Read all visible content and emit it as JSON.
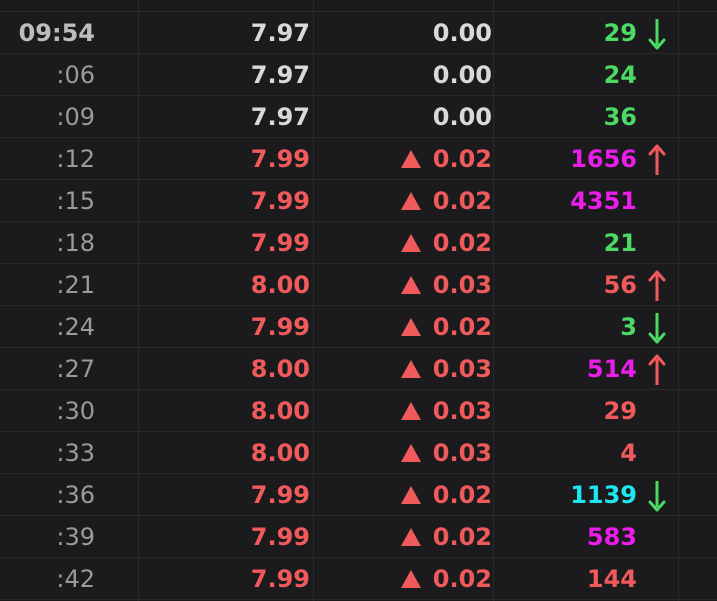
{
  "colors": {
    "background": "#1b1b1d",
    "up_red": "#f05a5a",
    "down_green": "#4cd964",
    "large_magenta": "#ea1dea",
    "huge_cyan": "#1ee6f0",
    "neutral_white": "#d9d9d9"
  },
  "rows": [
    {
      "time": "09:54",
      "price": "7.97",
      "change": "0.00",
      "volume": "29",
      "price_color": "white",
      "volume_color": "green",
      "up_tri": false,
      "arrow": "down"
    },
    {
      "time": ":06",
      "price": "7.97",
      "change": "0.00",
      "volume": "24",
      "price_color": "white",
      "volume_color": "green",
      "up_tri": false,
      "arrow": ""
    },
    {
      "time": ":09",
      "price": "7.97",
      "change": "0.00",
      "volume": "36",
      "price_color": "white",
      "volume_color": "green",
      "up_tri": false,
      "arrow": ""
    },
    {
      "time": ":12",
      "price": "7.99",
      "change": "0.02",
      "volume": "1656",
      "price_color": "red",
      "volume_color": "magenta",
      "up_tri": true,
      "arrow": "up"
    },
    {
      "time": ":15",
      "price": "7.99",
      "change": "0.02",
      "volume": "4351",
      "price_color": "red",
      "volume_color": "magenta",
      "up_tri": true,
      "arrow": ""
    },
    {
      "time": ":18",
      "price": "7.99",
      "change": "0.02",
      "volume": "21",
      "price_color": "red",
      "volume_color": "green",
      "up_tri": true,
      "arrow": ""
    },
    {
      "time": ":21",
      "price": "8.00",
      "change": "0.03",
      "volume": "56",
      "price_color": "red",
      "volume_color": "red",
      "up_tri": true,
      "arrow": "up"
    },
    {
      "time": ":24",
      "price": "7.99",
      "change": "0.02",
      "volume": "3",
      "price_color": "red",
      "volume_color": "green",
      "up_tri": true,
      "arrow": "down"
    },
    {
      "time": ":27",
      "price": "8.00",
      "change": "0.03",
      "volume": "514",
      "price_color": "red",
      "volume_color": "magenta",
      "up_tri": true,
      "arrow": "up"
    },
    {
      "time": ":30",
      "price": "8.00",
      "change": "0.03",
      "volume": "29",
      "price_color": "red",
      "volume_color": "red",
      "up_tri": true,
      "arrow": ""
    },
    {
      "time": ":33",
      "price": "8.00",
      "change": "0.03",
      "volume": "4",
      "price_color": "red",
      "volume_color": "red",
      "up_tri": true,
      "arrow": ""
    },
    {
      "time": ":36",
      "price": "7.99",
      "change": "0.02",
      "volume": "1139",
      "price_color": "red",
      "volume_color": "cyan",
      "up_tri": true,
      "arrow": "down"
    },
    {
      "time": ":39",
      "price": "7.99",
      "change": "0.02",
      "volume": "583",
      "price_color": "red",
      "volume_color": "magenta",
      "up_tri": true,
      "arrow": ""
    },
    {
      "time": ":42",
      "price": "7.99",
      "change": "0.02",
      "volume": "144",
      "price_color": "red",
      "volume_color": "red",
      "up_tri": true,
      "arrow": ""
    }
  ]
}
